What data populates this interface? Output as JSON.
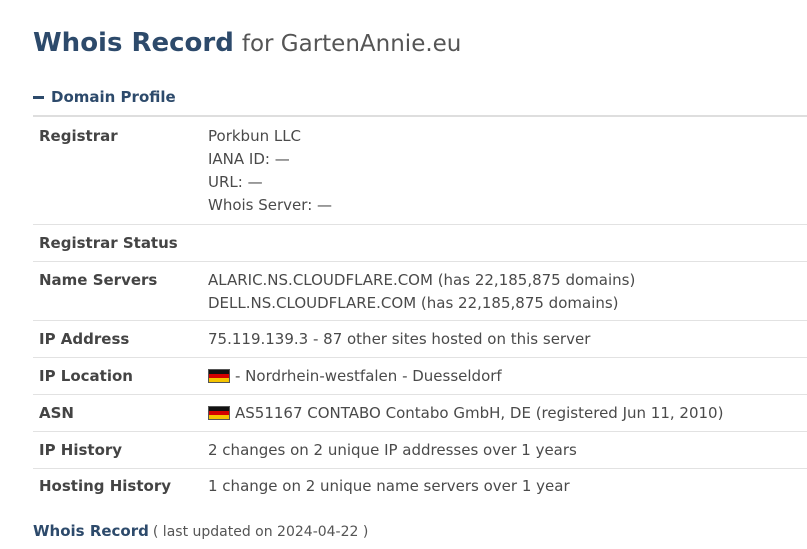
{
  "title": {
    "main": "Whois Record",
    "sub": "for GartenAnnie.eu"
  },
  "section": {
    "toggle_icon": "minus-icon",
    "label": "Domain Profile"
  },
  "rows": [
    {
      "label": "Registrar",
      "lines": [
        "Porkbun LLC",
        "IANA ID: —",
        "URL: —",
        "Whois Server: —"
      ]
    },
    {
      "label": "Registrar Status",
      "lines": []
    },
    {
      "label": "Name Servers",
      "lines": [
        "ALARIC.NS.CLOUDFLARE.COM (has 22,185,875 domains)",
        "DELL.NS.CLOUDFLARE.COM (has 22,185,875 domains)"
      ]
    },
    {
      "label": "IP Address",
      "lines": [
        "75.119.139.3 - 87 other sites hosted on this server"
      ]
    },
    {
      "label": "IP Location",
      "flag": "germany-flag-icon",
      "lines": [
        "- Nordrhein-westfalen - Duesseldorf"
      ]
    },
    {
      "label": "ASN",
      "flag": "germany-flag-icon",
      "lines": [
        "AS51167 CONTABO Contabo GmbH, DE (registered Jun 11, 2010)"
      ]
    },
    {
      "label": "IP History",
      "lines": [
        "2 changes on 2 unique IP addresses over 1 years"
      ]
    },
    {
      "label": "Hosting History",
      "lines": [
        "1 change on 2 unique name servers over 1 year"
      ]
    }
  ],
  "footer": {
    "link": "Whois Record",
    "meta": "( last updated on 2024-04-22 )"
  },
  "colors": {
    "heading": "#2d4a6b",
    "text": "#444444",
    "border": "#e2e2e2"
  }
}
